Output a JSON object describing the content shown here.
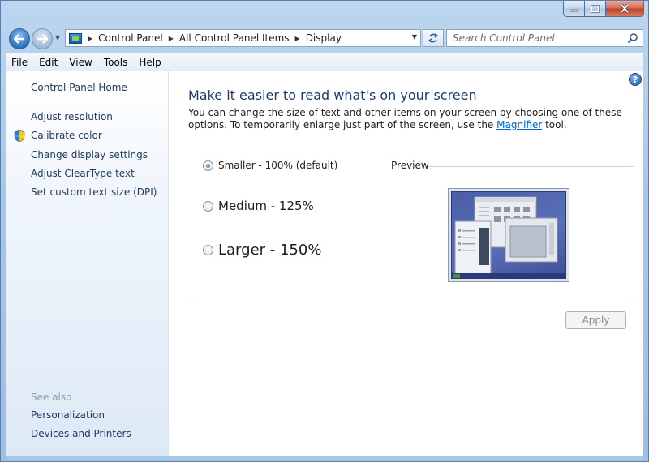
{
  "window": {
    "caption_buttons": [
      "minimize",
      "maximize",
      "close"
    ]
  },
  "address_bar": {
    "breadcrumbs": [
      "Control Panel",
      "All Control Panel Items",
      "Display"
    ],
    "search_placeholder": "Search Control Panel"
  },
  "menu": {
    "items": [
      "File",
      "Edit",
      "View",
      "Tools",
      "Help"
    ]
  },
  "sidebar": {
    "home": "Control Panel Home",
    "links": [
      "Adjust resolution",
      "Calibrate color",
      "Change display settings",
      "Adjust ClearType text",
      "Set custom text size (DPI)"
    ],
    "see_also_label": "See also",
    "see_also": [
      "Personalization",
      "Devices and Printers"
    ]
  },
  "main": {
    "heading": "Make it easier to read what's on your screen",
    "desc_before": "You can change the size of text and other items on your screen by choosing one of these options. To temporarily enlarge just part of the screen, use the ",
    "desc_link": "Magnifier",
    "desc_after": " tool.",
    "options": [
      {
        "label": "Smaller - 100% (default)",
        "checked": true
      },
      {
        "label": "Medium - 125%",
        "checked": false
      },
      {
        "label": "Larger - 150%",
        "checked": false
      }
    ],
    "preview_label": "Preview",
    "apply_label": "Apply",
    "help_glyph": "?"
  },
  "colors": {
    "link": "#1e395b",
    "heading": "#1e3a6e",
    "hyperlink": "#0066cc",
    "see_also": "#8a9bb0"
  }
}
